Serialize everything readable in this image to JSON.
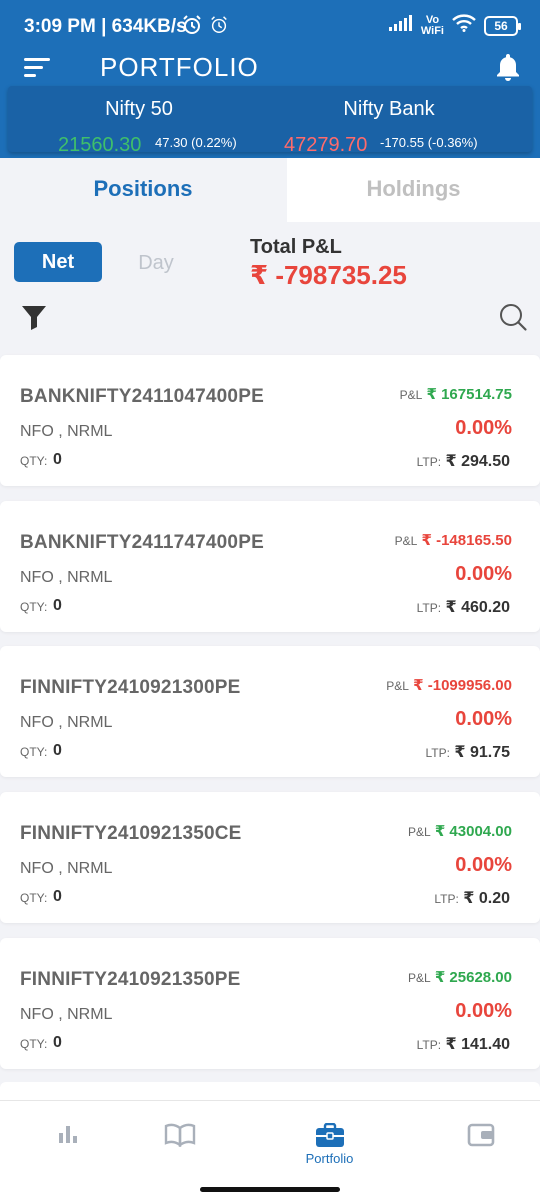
{
  "status_bar": {
    "time_speed": "3:09 PM | 634KB/s",
    "vo_wifi_top": "Vo",
    "vo_wifi_bottom": "WiFi",
    "battery": "56"
  },
  "header": {
    "title": "PORTFOLIO"
  },
  "indices": [
    {
      "name": "Nifty 50",
      "value": "21560.30",
      "change": "47.30 (0.22%)",
      "color": "#3fbf6b"
    },
    {
      "name": "Nifty Bank",
      "value": "47279.70",
      "change": "-170.55 (-0.36%)",
      "color": "#ff6b6b"
    }
  ],
  "tabs": {
    "positions": "Positions",
    "holdings": "Holdings"
  },
  "toggle": {
    "net": "Net",
    "day": "Day"
  },
  "total_pnl": {
    "label": "Total P&L",
    "value": "₹ -798735.25"
  },
  "labels": {
    "pnl": "P&L",
    "qty": "QTY:",
    "ltp": "LTP:"
  },
  "positions": [
    {
      "symbol": "BANKNIFTY2411047400PE",
      "exchange": "NFO , NRML",
      "qty": "0",
      "pnl": "₹ 167514.75",
      "pnl_color": "#2fa84f",
      "change": "0.00%",
      "ltp": "₹ 294.50"
    },
    {
      "symbol": "BANKNIFTY2411747400PE",
      "exchange": "NFO , NRML",
      "qty": "0",
      "pnl": "₹ -148165.50",
      "pnl_color": "#e8453c",
      "change": "0.00%",
      "ltp": "₹ 460.20"
    },
    {
      "symbol": "FINNIFTY2410921300PE",
      "exchange": "NFO , NRML",
      "qty": "0",
      "pnl": "₹ -1099956.00",
      "pnl_color": "#e8453c",
      "change": "0.00%",
      "ltp": "₹ 91.75"
    },
    {
      "symbol": "FINNIFTY2410921350CE",
      "exchange": "NFO , NRML",
      "qty": "0",
      "pnl": "₹ 43004.00",
      "pnl_color": "#2fa84f",
      "change": "0.00%",
      "ltp": "₹ 0.20"
    },
    {
      "symbol": "FINNIFTY2410921350PE",
      "exchange": "NFO , NRML",
      "qty": "0",
      "pnl": "₹ 25628.00",
      "pnl_color": "#2fa84f",
      "change": "0.00%",
      "ltp": "₹ 141.40"
    }
  ],
  "bottom_nav": {
    "portfolio_label": "Portfolio"
  },
  "colors": {
    "primary": "#1d6fb8",
    "loss": "#e8453c",
    "profit": "#2fa84f",
    "nav_inactive": "#a9b0ba"
  }
}
